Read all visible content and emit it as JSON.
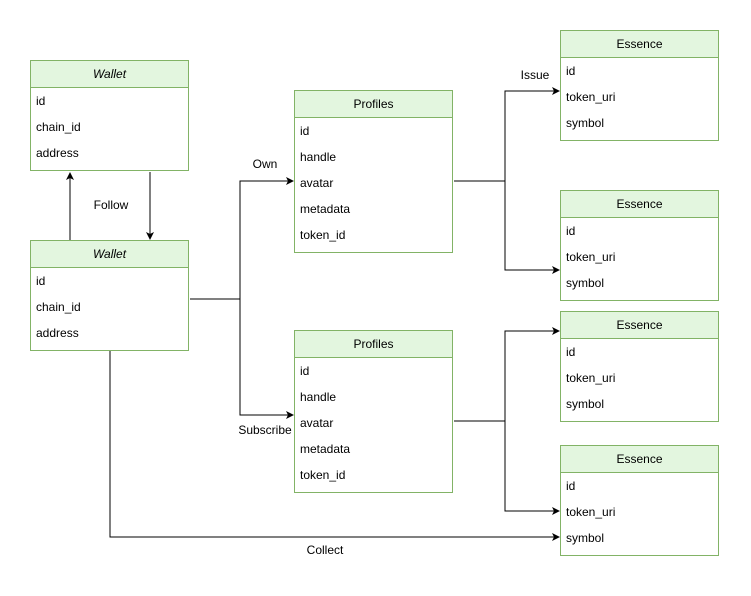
{
  "entities": {
    "wallet_a": {
      "title": "Wallet",
      "fields": [
        "id",
        "chain_id",
        "address"
      ]
    },
    "wallet_b": {
      "title": "Wallet",
      "fields": [
        "id",
        "chain_id",
        "address"
      ]
    },
    "profiles_a": {
      "title": "Profiles",
      "fields": [
        "id",
        "handle",
        "avatar",
        "metadata",
        "token_id"
      ]
    },
    "profiles_b": {
      "title": "Profiles",
      "fields": [
        "id",
        "handle",
        "avatar",
        "metadata",
        "token_id"
      ]
    },
    "essence_a": {
      "title": "Essence",
      "fields": [
        "id",
        "token_uri",
        "symbol"
      ]
    },
    "essence_b": {
      "title": "Essence",
      "fields": [
        "id",
        "token_uri",
        "symbol"
      ]
    },
    "essence_c": {
      "title": "Essence",
      "fields": [
        "id",
        "token_uri",
        "symbol"
      ]
    },
    "essence_d": {
      "title": "Essence",
      "fields": [
        "id",
        "token_uri",
        "symbol"
      ]
    }
  },
  "edge_labels": {
    "follow": "Follow",
    "own": "Own",
    "subscribe": "Subscribe",
    "issue": "Issue",
    "collect": "Collect"
  },
  "colors": {
    "header_fill": "#e3f6df",
    "border": "#82b366",
    "edge": "#000000"
  }
}
